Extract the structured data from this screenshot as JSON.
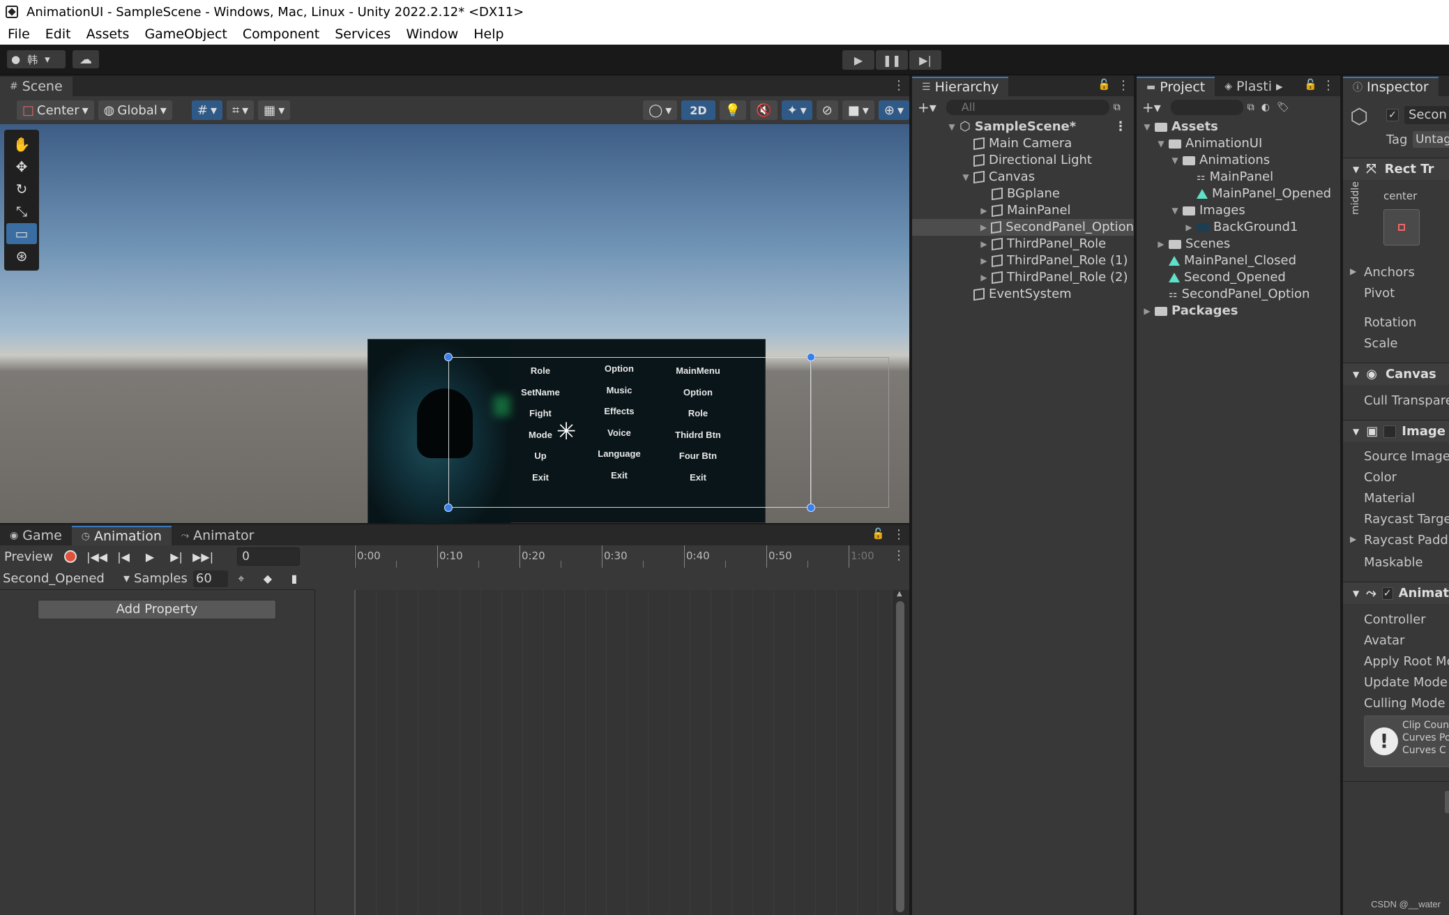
{
  "window": {
    "title": "AnimationUI - SampleScene - Windows, Mac, Linux - Unity 2022.2.12* <DX11>"
  },
  "menu": [
    "File",
    "Edit",
    "Assets",
    "GameObject",
    "Component",
    "Services",
    "Window",
    "Help"
  ],
  "toolbar": {
    "account_label": "韩",
    "play_icon": "▶",
    "pause_icon": "❚❚",
    "step_icon": "▶|"
  },
  "scene": {
    "tab": "Scene",
    "pivot": "Center",
    "space": "Global",
    "mode_2d": "2D",
    "canvas_columns": [
      [
        "Role",
        "SetName",
        "Fight",
        "Mode",
        "Up",
        "Exit"
      ],
      [
        "Option",
        "Music",
        "Effects",
        "Voice",
        "Language",
        "Exit"
      ],
      [
        "MainMenu",
        "Option",
        "Role",
        "Thidrd Btn",
        "Four Btn",
        "Exit"
      ]
    ]
  },
  "animation": {
    "tabs": [
      "Game",
      "Animation",
      "Animator"
    ],
    "preview": "Preview",
    "frame": "0",
    "clip": "Second_Opened",
    "samples_label": "Samples",
    "samples_value": "60",
    "add_property": "Add Property",
    "ruler": [
      "0:00",
      "0:10",
      "0:20",
      "0:30",
      "0:40",
      "0:50",
      "1:00"
    ]
  },
  "hierarchy": {
    "tab": "Hierarchy",
    "search_placeholder": "All",
    "scene": "SampleScene*",
    "items": [
      {
        "label": "Main Camera"
      },
      {
        "label": "Directional Light"
      },
      {
        "label": "Canvas"
      },
      {
        "label": "BGplane"
      },
      {
        "label": "MainPanel"
      },
      {
        "label": "SecondPanel_Option"
      },
      {
        "label": "ThirdPanel_Role"
      },
      {
        "label": "ThirdPanel_Role (1)"
      },
      {
        "label": "ThirdPanel_Role (2)"
      },
      {
        "label": "EventSystem"
      }
    ]
  },
  "project": {
    "tabs": [
      "Project",
      "Plasti"
    ],
    "items": [
      {
        "label": "Assets"
      },
      {
        "label": "AnimationUI"
      },
      {
        "label": "Animations"
      },
      {
        "label": "MainPanel"
      },
      {
        "label": "MainPanel_Opened"
      },
      {
        "label": "Images"
      },
      {
        "label": "BackGround1"
      },
      {
        "label": "Scenes"
      },
      {
        "label": "MainPanel_Closed"
      },
      {
        "label": "Second_Opened"
      },
      {
        "label": "SecondPanel_Option"
      },
      {
        "label": "Packages"
      }
    ]
  },
  "inspector": {
    "tab": "Inspector",
    "name": "Secon",
    "tag_label": "Tag",
    "tag_value": "Untag",
    "rect_transform": "Rect Tr",
    "anchor_h": "center",
    "anchor_v": "middle",
    "anchors": "Anchors",
    "pivot": "Pivot",
    "rotation": "Rotation",
    "scale": "Scale",
    "canvas": "Canvas",
    "cull": "Cull Transpare",
    "image": "Image",
    "source_image": "Source Image",
    "color": "Color",
    "material": "Material",
    "raycast_target": "Raycast Targe",
    "raycast_padding": "Raycast Paddi",
    "maskable": "Maskable",
    "animator": "Animat",
    "controller": "Controller",
    "avatar": "Avatar",
    "apply_root": "Apply Root Mo",
    "update_mode": "Update Mode",
    "culling_mode": "Culling Mode",
    "warning_lines": [
      "Clip Coun",
      "Curves Po",
      "Curves C"
    ]
  },
  "watermark": "CSDN @__water"
}
